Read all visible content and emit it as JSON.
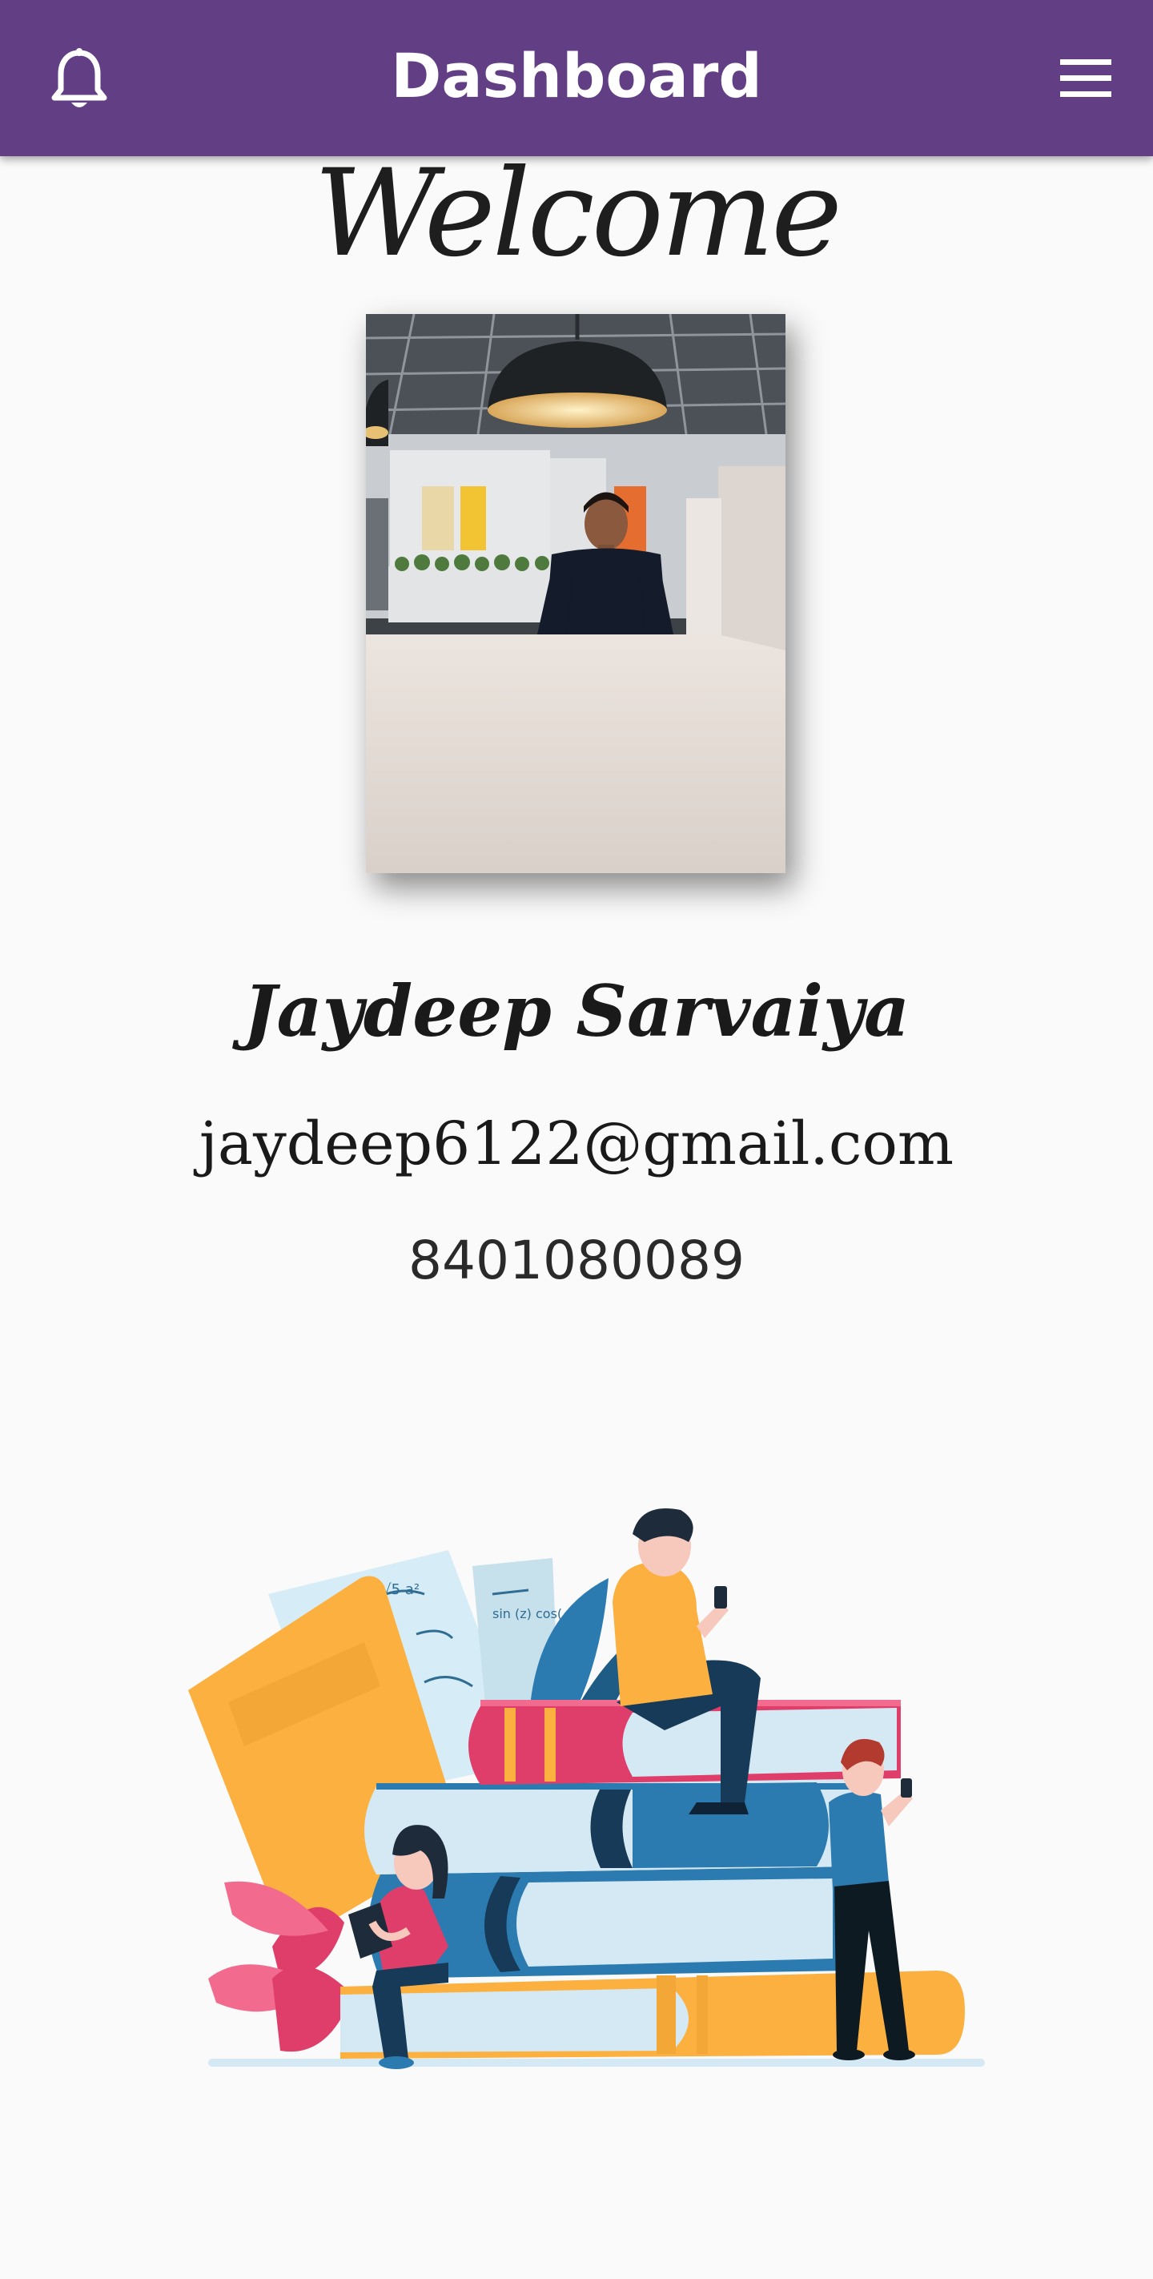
{
  "appbar": {
    "title": "Dashboard",
    "left_icon": "bell-icon",
    "right_icon": "hamburger-menu-icon",
    "color": "#623f85"
  },
  "welcome": {
    "text": "Welcome"
  },
  "profile": {
    "name": "Jaydeep Sarvaiya",
    "email": "jaydeep6122@gmail.com",
    "phone": "8401080089"
  },
  "illustration": {
    "formula_top": "0 √5  a²",
    "formula_right": "sin (z)  cos(",
    "colors": {
      "yellow": "#fbb040",
      "pink": "#e03e6a",
      "blue": "#2c7bb0",
      "navy": "#163a57",
      "light": "#d4e9f4"
    }
  }
}
